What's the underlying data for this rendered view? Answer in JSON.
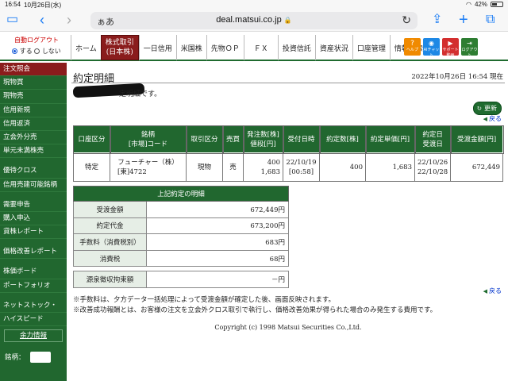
{
  "status_bar": {
    "time": "16:54",
    "date": "10月26日(水)",
    "battery": "42%"
  },
  "browser": {
    "aa": "ぁあ",
    "url": "deal.matsui.co.jp",
    "lock": "🔒"
  },
  "header": {
    "auto_logout_label": "自動ログアウト",
    "auto_logout_on": "する",
    "auto_logout_off": "しない",
    "nav": [
      {
        "label": "ホーム"
      },
      {
        "label": "株式取引",
        "label2": "(日本株)"
      },
      {
        "label": "一日信用"
      },
      {
        "label": "米国株"
      },
      {
        "label": "先物ＯＰ"
      },
      {
        "label": "ＦＸ"
      },
      {
        "label": "投資信託"
      },
      {
        "label": "資産状況"
      },
      {
        "label": "口座管理"
      },
      {
        "label": "情報検索"
      }
    ],
    "tiles": [
      {
        "label": "ヘルプ",
        "color": "#f08a00"
      },
      {
        "label": "AIチャット",
        "color": "#1e88e5"
      },
      {
        "label": "サポート動画",
        "color": "#d32f2f"
      },
      {
        "label": "ログアウト",
        "color": "#2e7d32"
      }
    ]
  },
  "sidebar": {
    "group1": [
      "注文照会",
      "現物買",
      "現物売",
      "信用新規",
      "信用返済",
      "立会外分売",
      "単元未満株売"
    ],
    "group2": [
      "優待クロス",
      "信用売建可能銘柄"
    ],
    "group3": [
      "需要申告",
      "購入申込",
      "貸株レポート"
    ],
    "group4": [
      "価格改善レポート"
    ],
    "group5": [
      "株価ボード",
      "ポートフォリオ"
    ],
    "group6": [
      "ネットストック・",
      "ハイスピード"
    ],
    "box_label": "余力情報",
    "ticker_label": "銘柄："
  },
  "main": {
    "title": "約定明細",
    "timestamp": "2022年10月26日 16:54 現在",
    "intro": "定明細です。",
    "update_button": "更新",
    "back_label": "戻る",
    "order_headers": [
      "口座区分",
      "銘柄",
      "[市場]コード",
      "取引区分",
      "売買",
      "発注数[株]",
      "値段[円]",
      "受付日時",
      "約定数[株]",
      "約定単価[円]",
      "約定日",
      "受渡日",
      "受渡金額[円]"
    ],
    "order_row": {
      "account": "特定",
      "stock_name": "フューチャー（株）",
      "stock_code": "[東]4722",
      "trade_type": "現物",
      "side": "売",
      "order_qty": "400",
      "order_price": "1,683",
      "received_date": "22/10/19",
      "received_time": "[00:58]",
      "exec_qty": "400",
      "exec_price": "1,683",
      "exec_date": "22/10/26",
      "settle_date": "22/10/28",
      "settle_amount": "672,449"
    },
    "detail_caption": "上記約定の明細",
    "details": [
      {
        "label": "受渡金額",
        "value": "672,449円"
      },
      {
        "label": "約定代金",
        "value": "673,200円"
      },
      {
        "label": "手数料（消費税別）",
        "value": "683円"
      },
      {
        "label": "消費税",
        "value": "68円"
      }
    ],
    "withholding": {
      "label": "源泉徴収拘束額",
      "value": "－円"
    },
    "notes": [
      "※手数料は、夕方データ一括処理によって受渡金額が確定した後、画面反映されます。",
      "※改善成功報酬とは、お客様の注文を立会外クロス取引で執行し、価格改善効果が得られた場合のみ発生する費用です。"
    ],
    "copyright": "Copyright (c) 1998 Matsui Securities Co.,Ltd."
  }
}
